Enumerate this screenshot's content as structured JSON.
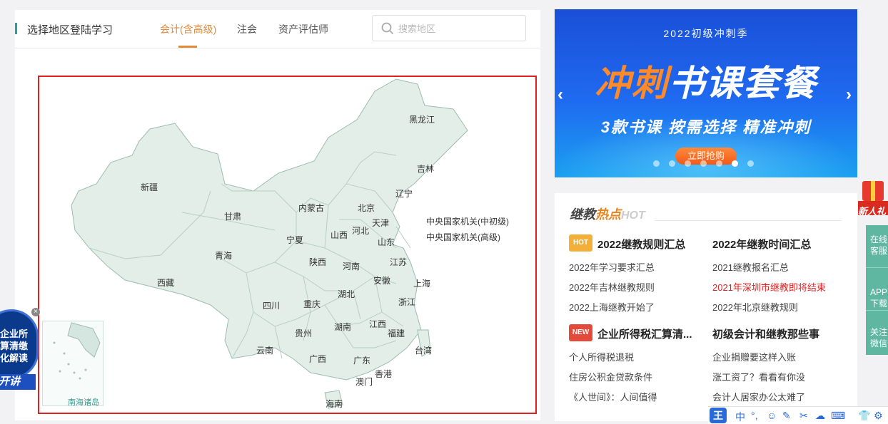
{
  "header": {
    "title": "选择地区登陆学习",
    "tabs": [
      {
        "label": "会计(含高级)",
        "active": true
      },
      {
        "label": "注会",
        "active": false
      },
      {
        "label": "资产评估师",
        "active": false
      }
    ],
    "search_placeholder": "搜索地区"
  },
  "map": {
    "provinces": [
      "黑龙江",
      "吉林",
      "辽宁",
      "内蒙古",
      "北京",
      "天津",
      "河北",
      "新疆",
      "甘肃",
      "宁夏",
      "山西",
      "山东",
      "青海",
      "陕西",
      "河南",
      "江苏",
      "西藏",
      "安徽",
      "上海",
      "湖北",
      "浙江",
      "四川",
      "重庆",
      "湖南",
      "江西",
      "贵州",
      "福建",
      "云南",
      "广西",
      "广东",
      "台湾",
      "香港",
      "澳门",
      "海南"
    ],
    "central": [
      "中央国家机关(中初级)",
      "中央国家机关(高级)"
    ],
    "inset_label": "南海诸岛"
  },
  "float_ad": {
    "lines": [
      "企业所",
      "算清缴",
      "化解读"
    ],
    "ribbon": "开讲",
    "close": "×"
  },
  "banner": {
    "season": "2022初级冲刺季",
    "headline_part1": "冲刺",
    "headline_part2": "书课套餐",
    "subline": "3款书课 按需选择 精准冲刺",
    "cta": "立即抢购",
    "prev": "‹",
    "next": "›",
    "dots": 7,
    "active_dot": 5
  },
  "hot": {
    "brand_part1": "继教",
    "brand_part2": "热点",
    "brand_part3": "HOT",
    "left_col_1": {
      "badge": "HOT",
      "title": "2022继教规则汇总",
      "links": [
        "2022年学习要求汇总",
        "2022年吉林继教规则",
        "2022上海继教开始了"
      ]
    },
    "right_col_1": {
      "title": "2022年继教时间汇总",
      "links": [
        "2021继教报名汇总",
        "2021年深圳市继教即将结束",
        "2022年北京继教规则"
      ]
    },
    "left_col_2": {
      "badge": "NEW",
      "title": "企业所得税汇算清...",
      "links": [
        "个人所得税退税",
        "住房公积金贷款条件",
        "《人世间》：人间值得"
      ]
    },
    "right_col_2": {
      "title": "初级会计和继教那些事",
      "links": [
        "企业捐赠要这样入账",
        "涨工资了？看看有你没",
        "会计人居家办公太难了"
      ]
    }
  },
  "side": {
    "gift": "新人礼",
    "tools": [
      "在线客服",
      "APP下载",
      "关注微信"
    ]
  },
  "ime": [
    "王",
    "中",
    "°,",
    "☺",
    "✎",
    "✂",
    "☁",
    "⌨",
    "👕",
    "⚙"
  ]
}
